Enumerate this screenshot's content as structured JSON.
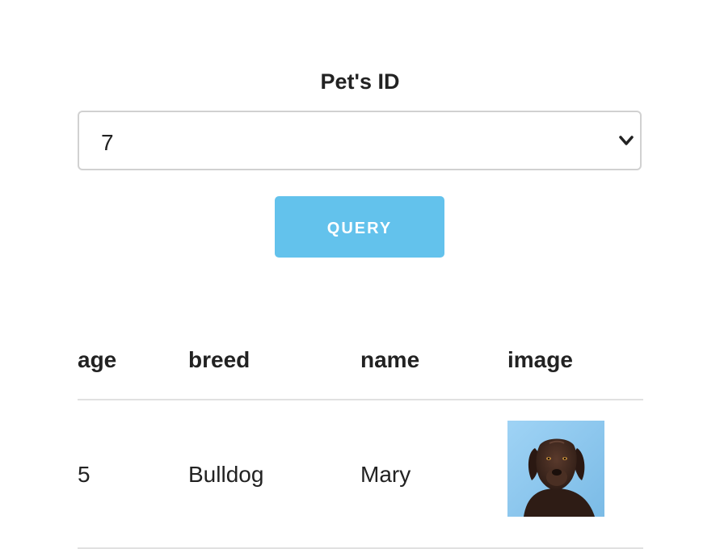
{
  "form": {
    "label": "Pet's ID",
    "select": {
      "selected": "7"
    },
    "query_button": "QUERY"
  },
  "table": {
    "headers": [
      "age",
      "breed",
      "name",
      "image"
    ],
    "rows": [
      {
        "age": "5",
        "breed": "Bulldog",
        "name": "Mary",
        "image": "dog-photo"
      }
    ]
  },
  "colors": {
    "accent": "#63c2ec",
    "text": "#222222",
    "border": "#d1d1d1",
    "divider": "#e1e1e1",
    "photo_bg": "#8cc8ef"
  }
}
